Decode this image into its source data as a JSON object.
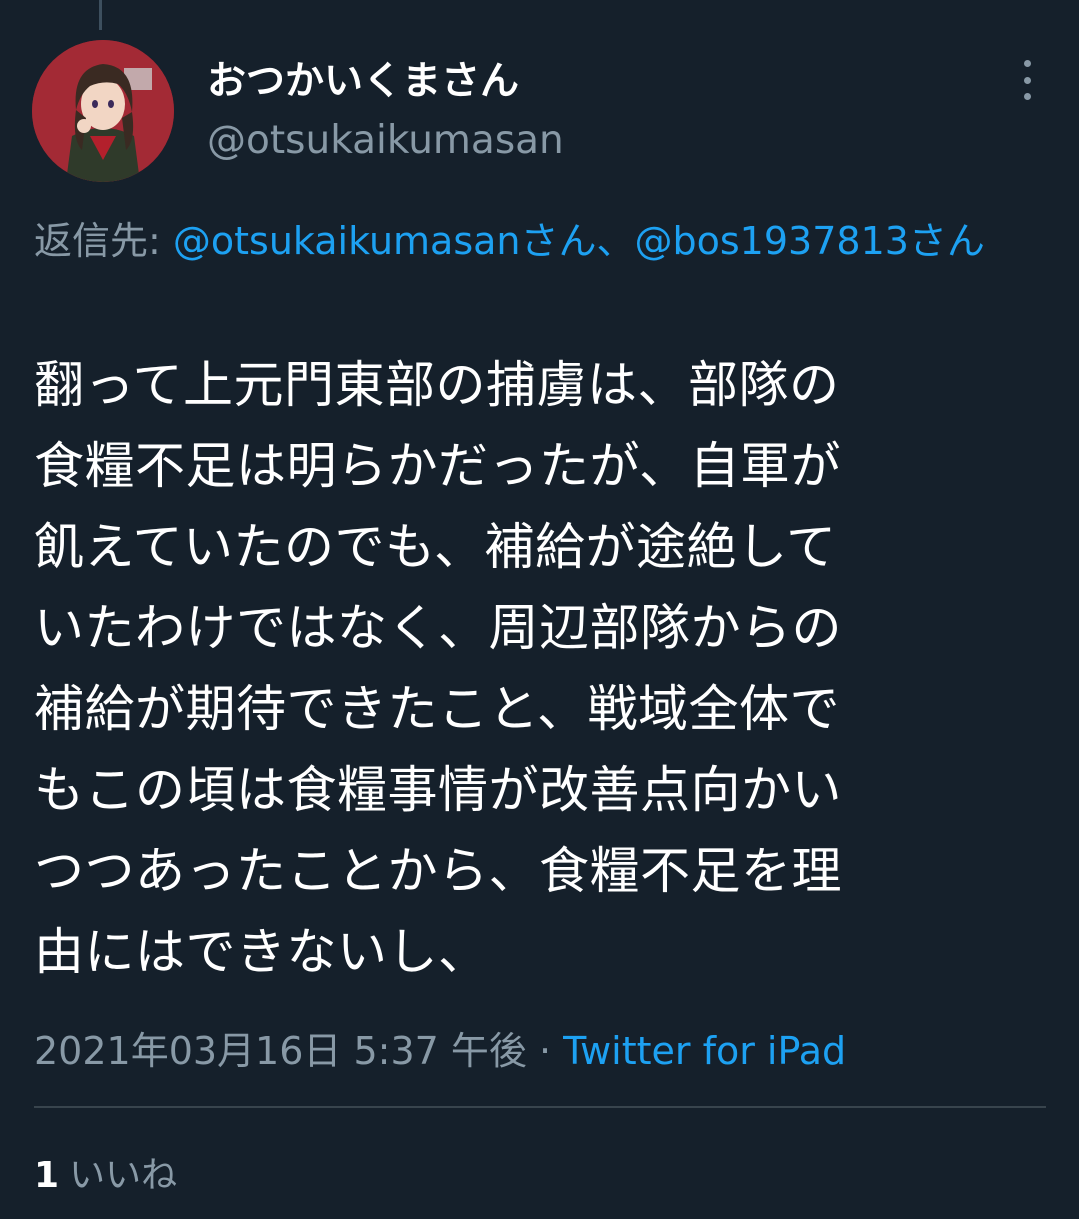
{
  "user": {
    "display_name": "おつかいくまさん",
    "handle": "@otsukaikumasan",
    "avatar_icon": "avatar-anime-character-icon"
  },
  "reply": {
    "prefix": "返信先: ",
    "mentions": [
      "@otsukaikumasanさん",
      "@bos1937813さん"
    ],
    "separator": "、"
  },
  "tweet": {
    "lines": [
      "翻って上元門東部の捕虜は、部隊の",
      "食糧不足は明らかだったが、自軍が",
      "飢えていたのでも、補給が途絶して",
      "いたわけではなく、周辺部隊からの",
      "補給が期待できたこと、戦域全体で",
      "もこの頃は食糧事情が改善点向かい",
      "つつあったことから、食糧不足を理",
      "由にはできないし、"
    ]
  },
  "meta": {
    "timestamp": "2021年03月16日 5:37 午後",
    "dot": " · ",
    "source": "Twitter for iPad"
  },
  "stats": {
    "like_count": "1",
    "like_label": "いいね"
  },
  "colors": {
    "background": "#15202b",
    "text": "#ffffff",
    "secondary": "#8899a6",
    "accent": "#1da1f2",
    "divider": "#38444d"
  }
}
